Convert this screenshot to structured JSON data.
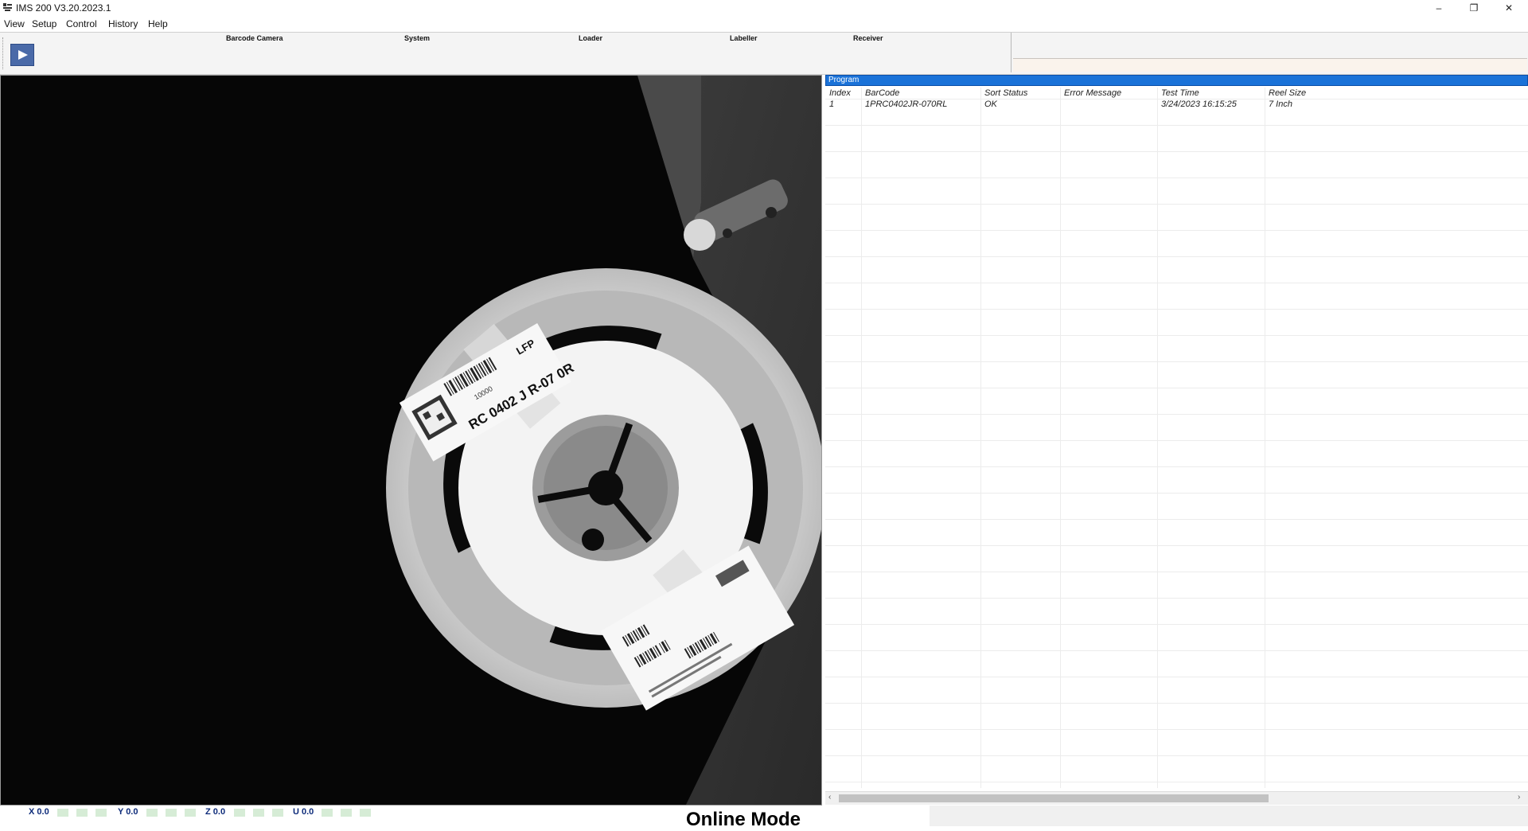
{
  "window": {
    "title": "IMS 200 V3.20.2023.1",
    "controls": {
      "minimize": "–",
      "maximize": "❐",
      "close": "✕"
    }
  },
  "menu": [
    "View",
    "Setup",
    "Control",
    "History",
    "Help"
  ],
  "toolbar": {
    "play_icon": "play-icon",
    "sections": [
      "Barcode Camera",
      "System",
      "Loader",
      "Labeller",
      "Receiver"
    ]
  },
  "program": {
    "title": "Program",
    "columns": [
      "Index",
      "BarCode",
      "Sort Status",
      "Error Message",
      "Test Time",
      "Reel Size"
    ],
    "rows": [
      [
        "1",
        "1PRC0402JR-070RL",
        "OK",
        "",
        "3/24/2023 16:15:25",
        "7 Inch"
      ]
    ]
  },
  "camera_image": {
    "reel_label_top": "RC 0402 J R-07 0R",
    "reel_label_top_tag": "LFP",
    "reel_label_top_qty": "10000"
  },
  "status": {
    "axes": [
      {
        "label": "X 0.0"
      },
      {
        "label": "Y 0.0"
      },
      {
        "label": "Z 0.0"
      },
      {
        "label": "U 0.0"
      }
    ],
    "mode": "Online Mode",
    "colors": {
      "axis": "#0d2b7a",
      "led": "#d6ecd6",
      "header": "#1a72d8"
    }
  }
}
